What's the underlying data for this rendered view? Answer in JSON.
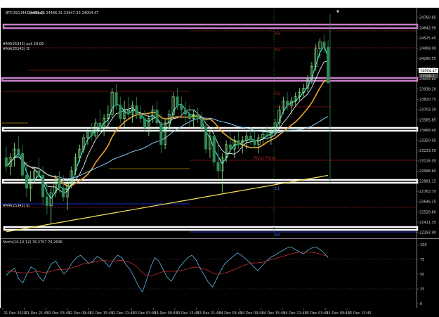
{
  "window": {
    "title": "BTCUSD,M45 (offline)",
    "ohlc_line": "24403.26 24466.31 23947.33 24004.47"
  },
  "chart_data": [
    {
      "type": "candlestick",
      "title": "BTCUSD,M45 (offline)",
      "grid": false,
      "y_ticks": [
        "24760.85",
        "24642.90",
        "24525.45",
        "24408.00",
        "24290.55",
        "24173.10",
        "24055.65",
        "23938.20",
        "23820.75",
        "23703.30",
        "23585.85",
        "23468.40",
        "23350.95",
        "23233.50",
        "23116.05",
        "22998.60",
        "22881.15",
        "22763.70",
        "22646.25",
        "22528.80",
        "22411.35",
        "22293.90"
      ],
      "ylim": [
        22250,
        24800
      ],
      "x_ticks": [
        "21 Dec 2020",
        "21 Dec 21:45",
        "22 Dec 03:45",
        "22 Dec 09:45",
        "22 Dec 15:45",
        "22 Dec 21:45",
        "23 Dec 03:45",
        "23 Dec 09:45",
        "23 Dec 15:45",
        "23 Dec 21:45",
        "24 Dec 03:45",
        "24 Dec 09:45",
        "24 Dec 15:45",
        "24 Dec 21:45",
        "25 Dec 03:45",
        "25 Dec 09:45",
        "25 Dec 15:45"
      ],
      "indicator_labels": [
        "#MA(25342) poll 29.09",
        "#MA(25342) l3"
      ],
      "bottom_indicator_label": "#MA(25342) lo",
      "current_price": "24004.47",
      "secondary_price": "23998.1",
      "level_labels": [
        "R3",
        "R2",
        "R1",
        "Pivot Point",
        "S1",
        "S3"
      ],
      "candles": [
        {
          "o": 23150,
          "h": 23280,
          "l": 22980,
          "c": 23050
        },
        {
          "o": 23050,
          "h": 23200,
          "l": 22950,
          "c": 23150
        },
        {
          "o": 23150,
          "h": 23320,
          "l": 23050,
          "c": 23250
        },
        {
          "o": 23250,
          "h": 23400,
          "l": 23150,
          "c": 23200
        },
        {
          "o": 23200,
          "h": 23300,
          "l": 22900,
          "c": 22950
        },
        {
          "o": 22950,
          "h": 23100,
          "l": 22700,
          "c": 22800
        },
        {
          "o": 22800,
          "h": 23000,
          "l": 22650,
          "c": 22900
        },
        {
          "o": 22900,
          "h": 23050,
          "l": 22850,
          "c": 23000
        },
        {
          "o": 23000,
          "h": 23150,
          "l": 22900,
          "c": 22950
        },
        {
          "o": 22950,
          "h": 23050,
          "l": 22600,
          "c": 22700
        },
        {
          "o": 22700,
          "h": 22850,
          "l": 22500,
          "c": 22600
        },
        {
          "o": 22600,
          "h": 22800,
          "l": 22400,
          "c": 22750
        },
        {
          "o": 22750,
          "h": 22950,
          "l": 22700,
          "c": 22900
        },
        {
          "o": 22900,
          "h": 23000,
          "l": 22750,
          "c": 22800
        },
        {
          "o": 22800,
          "h": 22950,
          "l": 22650,
          "c": 22700
        },
        {
          "o": 22700,
          "h": 22900,
          "l": 22550,
          "c": 22850
        },
        {
          "o": 22850,
          "h": 23050,
          "l": 22800,
          "c": 23000
        },
        {
          "o": 23000,
          "h": 23200,
          "l": 22950,
          "c": 23150
        },
        {
          "o": 23150,
          "h": 23300,
          "l": 23100,
          "c": 23250
        },
        {
          "o": 23250,
          "h": 23420,
          "l": 23200,
          "c": 23380
        },
        {
          "o": 23380,
          "h": 23500,
          "l": 23300,
          "c": 23450
        },
        {
          "o": 23450,
          "h": 23550,
          "l": 23350,
          "c": 23400
        },
        {
          "o": 23400,
          "h": 23600,
          "l": 23380,
          "c": 23550
        },
        {
          "o": 23550,
          "h": 23700,
          "l": 23450,
          "c": 23500
        },
        {
          "o": 23500,
          "h": 23650,
          "l": 23400,
          "c": 23600
        },
        {
          "o": 23600,
          "h": 23750,
          "l": 23500,
          "c": 23650
        },
        {
          "o": 23650,
          "h": 23950,
          "l": 23600,
          "c": 23900
        },
        {
          "o": 23900,
          "h": 24000,
          "l": 23700,
          "c": 23750
        },
        {
          "o": 23750,
          "h": 23850,
          "l": 23550,
          "c": 23600
        },
        {
          "o": 23600,
          "h": 23800,
          "l": 23500,
          "c": 23700
        },
        {
          "o": 23700,
          "h": 23850,
          "l": 23600,
          "c": 23650
        },
        {
          "o": 23650,
          "h": 23800,
          "l": 23550,
          "c": 23750
        },
        {
          "o": 23750,
          "h": 23850,
          "l": 23600,
          "c": 23650
        },
        {
          "o": 23650,
          "h": 23750,
          "l": 23550,
          "c": 23600
        },
        {
          "o": 23600,
          "h": 23700,
          "l": 23450,
          "c": 23500
        },
        {
          "o": 23500,
          "h": 23650,
          "l": 23400,
          "c": 23600
        },
        {
          "o": 23600,
          "h": 23750,
          "l": 23550,
          "c": 23700
        },
        {
          "o": 23700,
          "h": 23800,
          "l": 23500,
          "c": 23550
        },
        {
          "o": 23550,
          "h": 23650,
          "l": 23200,
          "c": 23300
        },
        {
          "o": 23300,
          "h": 23600,
          "l": 23250,
          "c": 23550
        },
        {
          "o": 23550,
          "h": 23700,
          "l": 23450,
          "c": 23650
        },
        {
          "o": 23650,
          "h": 23900,
          "l": 23600,
          "c": 23850
        },
        {
          "o": 23850,
          "h": 23950,
          "l": 23700,
          "c": 23750
        },
        {
          "o": 23750,
          "h": 23850,
          "l": 23600,
          "c": 23700
        },
        {
          "o": 23700,
          "h": 23800,
          "l": 23550,
          "c": 23650
        },
        {
          "o": 23650,
          "h": 23750,
          "l": 23500,
          "c": 23600
        },
        {
          "o": 23600,
          "h": 23700,
          "l": 23500,
          "c": 23650
        },
        {
          "o": 23650,
          "h": 23720,
          "l": 23550,
          "c": 23600
        },
        {
          "o": 23600,
          "h": 23680,
          "l": 23450,
          "c": 23500
        },
        {
          "o": 23500,
          "h": 23600,
          "l": 23200,
          "c": 23250
        },
        {
          "o": 23250,
          "h": 23450,
          "l": 23150,
          "c": 23400
        },
        {
          "o": 23400,
          "h": 23500,
          "l": 23050,
          "c": 23100
        },
        {
          "o": 23100,
          "h": 23300,
          "l": 22900,
          "c": 23000
        },
        {
          "o": 23000,
          "h": 23200,
          "l": 22750,
          "c": 23150
        },
        {
          "o": 23150,
          "h": 23350,
          "l": 23100,
          "c": 23300
        },
        {
          "o": 23300,
          "h": 23450,
          "l": 23200,
          "c": 23250
        },
        {
          "o": 23250,
          "h": 23400,
          "l": 23150,
          "c": 23350
        },
        {
          "o": 23350,
          "h": 23450,
          "l": 23250,
          "c": 23300
        },
        {
          "o": 23300,
          "h": 23400,
          "l": 23200,
          "c": 23350
        },
        {
          "o": 23350,
          "h": 23450,
          "l": 23250,
          "c": 23400
        },
        {
          "o": 23400,
          "h": 23500,
          "l": 23300,
          "c": 23350
        },
        {
          "o": 23350,
          "h": 23450,
          "l": 23250,
          "c": 23300
        },
        {
          "o": 23300,
          "h": 23420,
          "l": 23200,
          "c": 23380
        },
        {
          "o": 23380,
          "h": 23480,
          "l": 23300,
          "c": 23420
        },
        {
          "o": 23420,
          "h": 23520,
          "l": 23350,
          "c": 23400
        },
        {
          "o": 23400,
          "h": 23500,
          "l": 23300,
          "c": 23450
        },
        {
          "o": 23450,
          "h": 23600,
          "l": 23400,
          "c": 23550
        },
        {
          "o": 23550,
          "h": 23750,
          "l": 23500,
          "c": 23700
        },
        {
          "o": 23700,
          "h": 23850,
          "l": 23650,
          "c": 23800
        },
        {
          "o": 23800,
          "h": 23900,
          "l": 23700,
          "c": 23750
        },
        {
          "o": 23750,
          "h": 23850,
          "l": 23650,
          "c": 23800
        },
        {
          "o": 23800,
          "h": 23900,
          "l": 23750,
          "c": 23850
        },
        {
          "o": 23850,
          "h": 23950,
          "l": 23800,
          "c": 23900
        },
        {
          "o": 23900,
          "h": 24000,
          "l": 23850,
          "c": 23950
        },
        {
          "o": 23950,
          "h": 24100,
          "l": 23900,
          "c": 24050
        },
        {
          "o": 24050,
          "h": 24250,
          "l": 24000,
          "c": 24200
        },
        {
          "o": 24200,
          "h": 24450,
          "l": 24150,
          "c": 24400
        },
        {
          "o": 24400,
          "h": 24520,
          "l": 24300,
          "c": 24480
        },
        {
          "o": 24480,
          "h": 24560,
          "l": 24350,
          "c": 24420
        },
        {
          "o": 24420,
          "h": 24500,
          "l": 24000,
          "c": 24010
        }
      ],
      "stoch_label": "Stoch(10,10,12) 76.2707 76.2636",
      "stoch_ylim": [
        0,
        100
      ],
      "stoch_ticks": [
        "100",
        "75",
        "50",
        "25",
        "0"
      ],
      "stoch_k": [
        48,
        55,
        60,
        42,
        35,
        50,
        62,
        58,
        45,
        38,
        55,
        68,
        72,
        60,
        50,
        58,
        70,
        78,
        82,
        75,
        68,
        72,
        80,
        76,
        70,
        62,
        74,
        82,
        78,
        66,
        58,
        45,
        30,
        20,
        40,
        62,
        78,
        72,
        58,
        45,
        38,
        50,
        62,
        70,
        78,
        82,
        74,
        60,
        48,
        36,
        28,
        42,
        56,
        68,
        74,
        80,
        86,
        82,
        76,
        70,
        62,
        56,
        64,
        72,
        78,
        82,
        86,
        90,
        94,
        96,
        92,
        88,
        84,
        90,
        94,
        96,
        92,
        86,
        78
      ],
      "stoch_d": [
        55,
        55,
        54,
        53,
        52,
        52,
        53,
        54,
        54,
        53,
        53,
        55,
        57,
        58,
        58,
        59,
        61,
        63,
        66,
        68,
        69,
        70,
        72,
        73,
        73,
        72,
        72,
        73,
        73,
        72,
        70,
        66,
        60,
        52,
        48,
        47,
        49,
        52,
        54,
        55,
        55,
        55,
        56,
        57,
        59,
        61,
        62,
        61,
        59,
        56,
        52,
        50,
        50,
        52,
        54,
        57,
        60,
        63,
        66,
        68,
        69,
        69,
        70,
        72,
        74,
        76,
        78,
        80,
        82,
        84,
        86,
        87,
        87,
        87,
        87,
        86,
        84,
        82,
        80
      ]
    }
  ]
}
